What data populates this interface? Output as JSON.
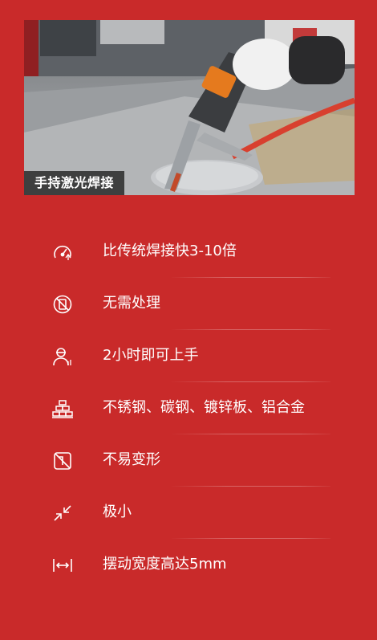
{
  "hero": {
    "caption": "手持激光焊接"
  },
  "features": [
    {
      "icon": "speedometer-icon",
      "label": "比传统焊接快3-10倍"
    },
    {
      "icon": "no-treatment-icon",
      "label": "无需处理"
    },
    {
      "icon": "worker-icon",
      "label": "2小时即可上手"
    },
    {
      "icon": "metal-stack-icon",
      "label": "不锈钢、碳钢、镀锌板、铝合金"
    },
    {
      "icon": "no-deform-icon",
      "label": "不易变形"
    },
    {
      "icon": "shrink-arrows-icon",
      "label": "极小"
    },
    {
      "icon": "width-arrows-icon",
      "label": "摆动宽度高达5mm"
    }
  ],
  "colors": {
    "background": "#c92a2a",
    "text": "#ffffff",
    "caption_bg": "#1e1e1e"
  }
}
